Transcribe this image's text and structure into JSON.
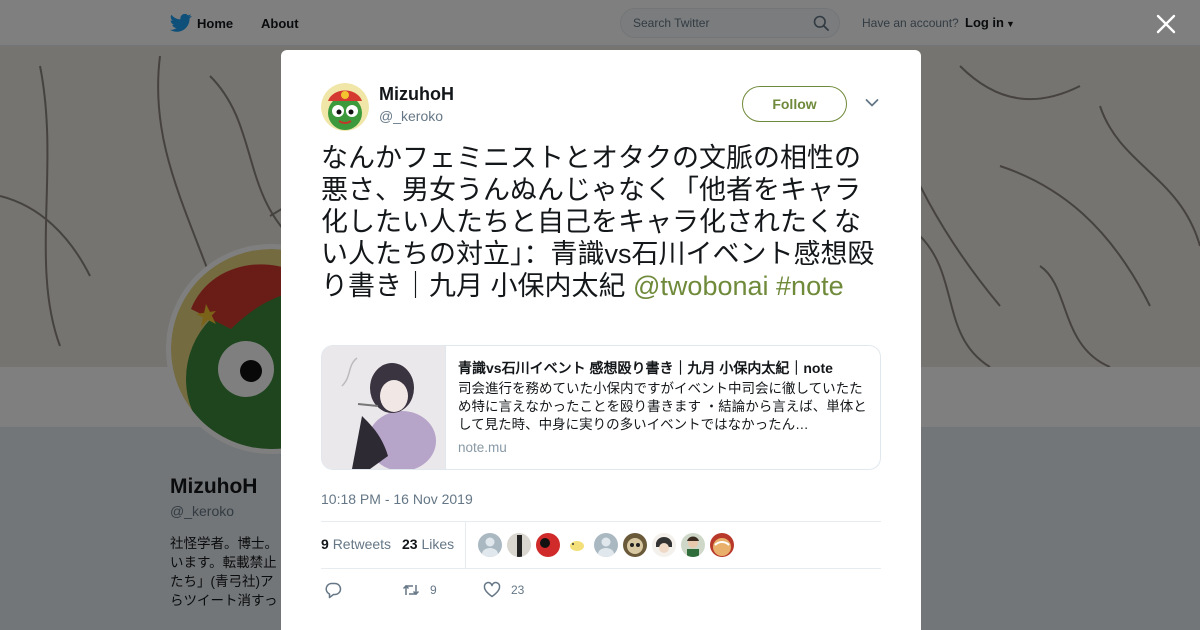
{
  "nav": {
    "home": "Home",
    "about": "About",
    "search_placeholder": "Search Twitter",
    "account_prompt": "Have an account?",
    "login": "Log in"
  },
  "profile": {
    "name": "MizuhoH",
    "handle": "@_keroko",
    "bio": "社怪学者。博士。\nいます。転載禁止\nたち」(青弓社)ア\nらツイート消すっ"
  },
  "tweet": {
    "author_name": "MizuhoH",
    "author_handle": "@_keroko",
    "follow_label": "Follow",
    "text": "なんかフェミニストとオタクの文脈の相性の悪さ、男女うんぬんじゃなく「他者をキャラ化したい人たちと自己をキャラ化されたくない人たちの対立」：青識vs石川イベント感想殴り書き｜九月 小保内太紀 ",
    "mention": "@twobonai",
    "hashtag": "#note",
    "card": {
      "title": "青識vs石川イベント 感想殴り書き｜九月 小保内太紀｜note",
      "description": "司会進行を務めていた小保内ですがイベント中司会に徹していたため特に言えなかったことを殴り書きます ・結論から言えば、単体として見た時、中身に実りの多いイベントではなかったん…",
      "domain": "note.mu"
    },
    "timestamp": "10:18 PM - 16 Nov 2019",
    "retweets": "9",
    "retweets_label": "Retweets",
    "likes": "23",
    "likes_label": "Likes",
    "actions": {
      "retweet_count": "9",
      "like_count": "23"
    }
  },
  "colors": {
    "accent": "#6f8a3b",
    "secondary_text": "#657786",
    "twitter_blue": "#1da1f2"
  }
}
